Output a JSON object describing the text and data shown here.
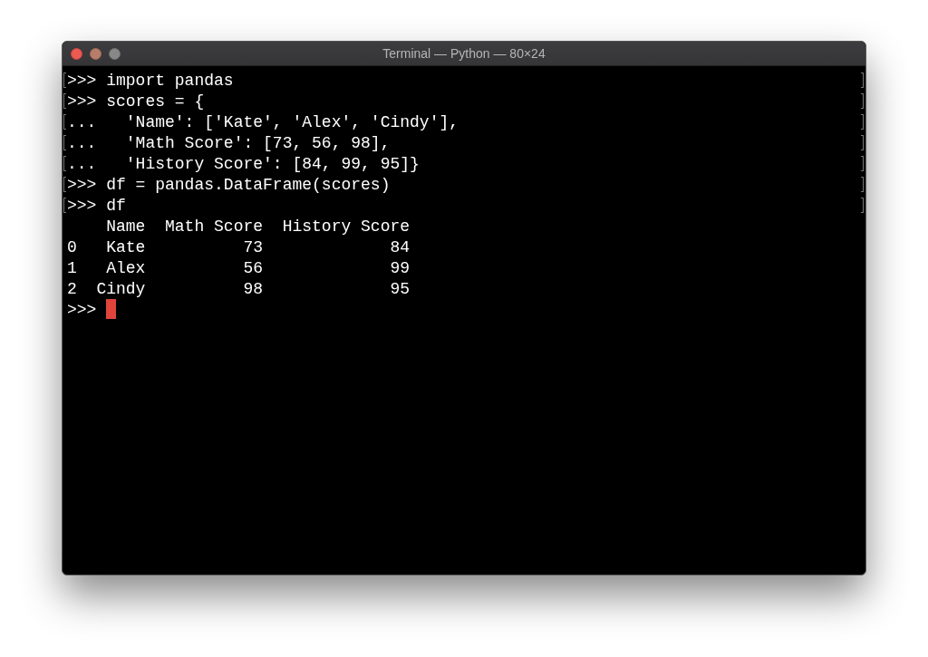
{
  "window": {
    "title": "Terminal — Python — 80×24",
    "buttons": [
      {
        "kind": "close",
        "color": "#ec5a52"
      },
      {
        "kind": "minimize",
        "color": "#b87d6a"
      },
      {
        "kind": "zoom",
        "color": "#888888"
      }
    ]
  },
  "terminal": {
    "lines": [
      {
        "text": ">>> import pandas",
        "marked": true
      },
      {
        "text": ">>> scores = {",
        "marked": true
      },
      {
        "text": "...   'Name': ['Kate', 'Alex', 'Cindy'],",
        "marked": true
      },
      {
        "text": "...   'Math Score': [73, 56, 98],",
        "marked": true
      },
      {
        "text": "...   'History Score': [84, 99, 95]}",
        "marked": true
      },
      {
        "text": ">>> df = pandas.DataFrame(scores)",
        "marked": true
      },
      {
        "text": ">>> df",
        "marked": true
      },
      {
        "text": "    Name  Math Score  History Score",
        "marked": false
      },
      {
        "text": "0   Kate          73             84",
        "marked": false
      },
      {
        "text": "1   Alex          56             99",
        "marked": false
      },
      {
        "text": "2  Cindy          98             95",
        "marked": false
      },
      {
        "text": ">>> ",
        "marked": false,
        "cursor": true
      }
    ]
  }
}
